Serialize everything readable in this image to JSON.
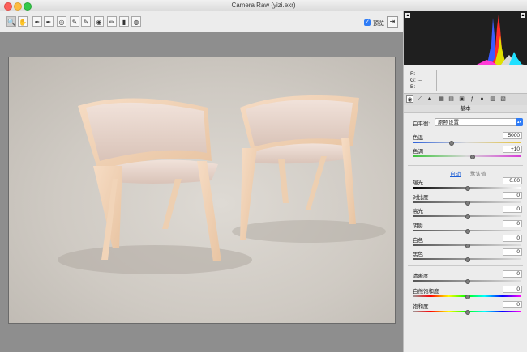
{
  "window": {
    "title": "Camera Raw (yizi.exr)"
  },
  "toolbar": {
    "tools": [
      {
        "name": "zoom-tool-icon",
        "glyph": "🔍"
      },
      {
        "name": "hand-tool-icon",
        "glyph": "✋"
      },
      {
        "name": "white-balance-tool-icon",
        "glyph": "✒"
      },
      {
        "name": "color-sampler-tool-icon",
        "glyph": "✒"
      },
      {
        "name": "targeted-adjustment-tool-icon",
        "glyph": "◎"
      },
      {
        "name": "transform-tool-icon",
        "glyph": "✎"
      },
      {
        "name": "spot-removal-tool-icon",
        "glyph": "✎"
      },
      {
        "name": "red-eye-tool-icon",
        "glyph": "◉"
      },
      {
        "name": "adjustment-brush-icon",
        "glyph": "✏"
      },
      {
        "name": "graduated-filter-icon",
        "glyph": "▮"
      },
      {
        "name": "radial-filter-icon",
        "glyph": "◍"
      }
    ],
    "preview_label": "预览",
    "preview_checked": true
  },
  "info": {
    "r": "R:   ---",
    "g": "G:   ---",
    "b": "B:   ---"
  },
  "panel": {
    "section_title": "基本",
    "white_balance": {
      "label": "白平衡:",
      "value": "原照设置"
    },
    "temperature": {
      "label": "色温",
      "value": "5000",
      "position": 0.35
    },
    "tint": {
      "label": "色调",
      "value": "+10",
      "position": 0.55
    },
    "auto_label": "自动",
    "default_label": "默认值",
    "exposure": {
      "label": "曝光",
      "value": "0.00",
      "position": 0.5
    },
    "contrast": {
      "label": "对比度",
      "value": "0",
      "position": 0.5
    },
    "highlights": {
      "label": "高光",
      "value": "0",
      "position": 0.5
    },
    "shadows": {
      "label": "阴影",
      "value": "0",
      "position": 0.5
    },
    "whites": {
      "label": "白色",
      "value": "0",
      "position": 0.5
    },
    "blacks": {
      "label": "黑色",
      "value": "0",
      "position": 0.5
    },
    "clarity": {
      "label": "清晰度",
      "value": "0",
      "position": 0.5
    },
    "vibrance": {
      "label": "自然饱和度",
      "value": "0",
      "position": 0.5
    },
    "saturation": {
      "label": "饱和度",
      "value": "0",
      "position": 0.5
    }
  },
  "colors": {
    "accent": "#2f7cf6",
    "link": "#1e5fd6"
  }
}
